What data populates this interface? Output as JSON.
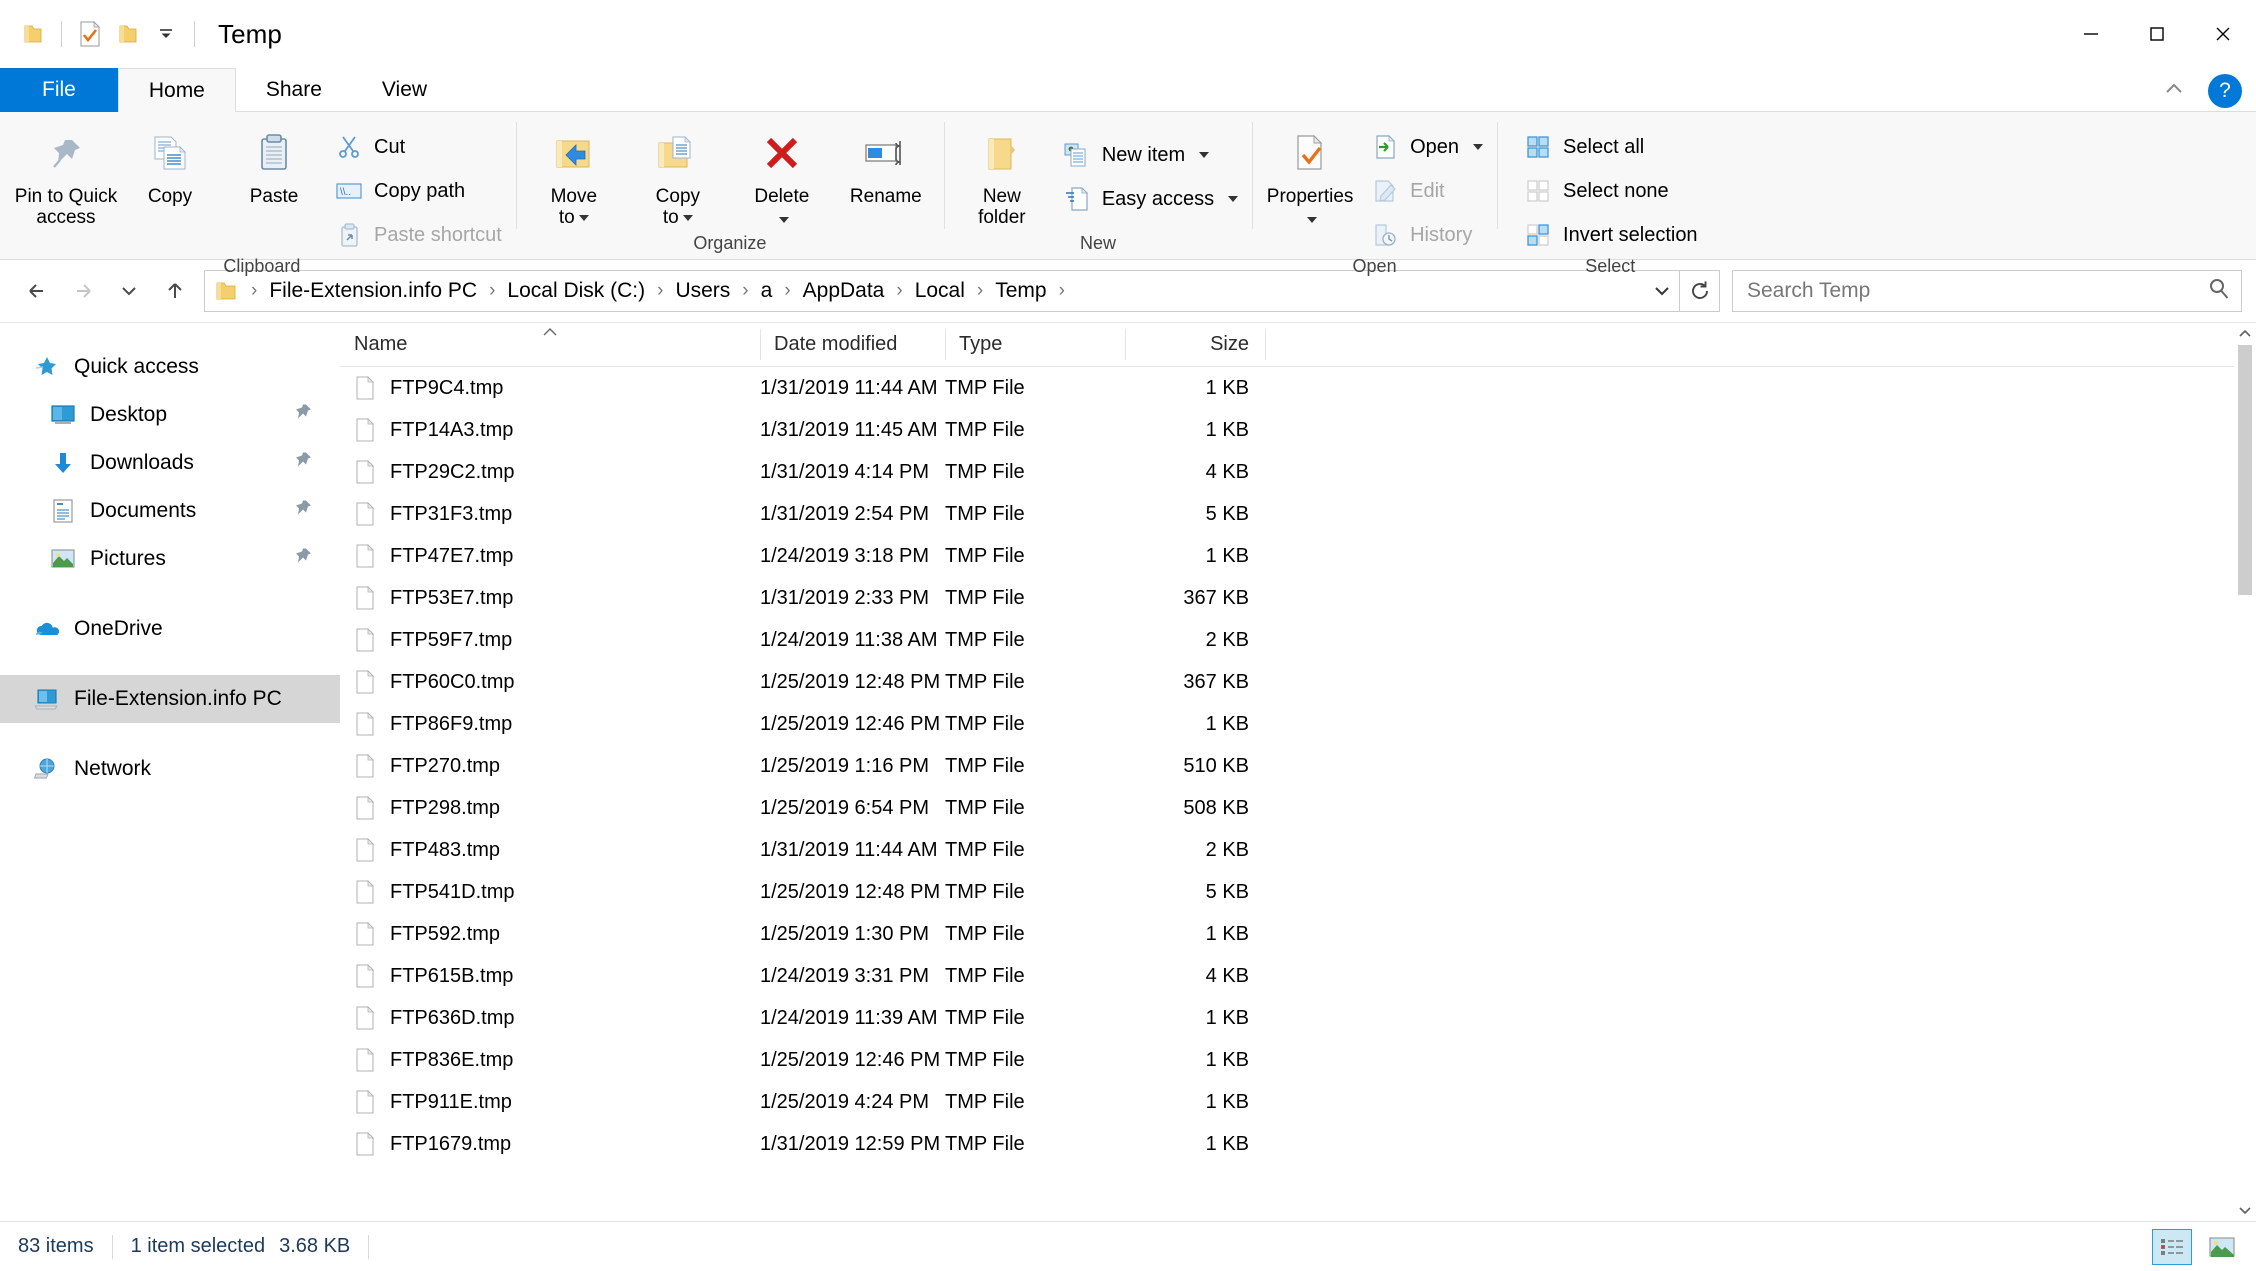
{
  "window": {
    "title": "Temp",
    "quick_access": [
      "folder-icon",
      "properties-icon",
      "new-folder-icon",
      "customize-qat-dropdown"
    ],
    "controls": {
      "minimize": "minimize-button",
      "maximize": "maximize-button",
      "close": "close-button"
    }
  },
  "tabs": [
    {
      "id": "file",
      "label": "File"
    },
    {
      "id": "home",
      "label": "Home"
    },
    {
      "id": "share",
      "label": "Share"
    },
    {
      "id": "view",
      "label": "View"
    }
  ],
  "active_tab": "Home",
  "ribbon": {
    "collapse_label": "collapse-ribbon-icon",
    "help_label": "?",
    "groups": [
      {
        "name": "Clipboard",
        "label": "Clipboard",
        "big_buttons": [
          {
            "label": "Pin to Quick\naccess",
            "line1": "Pin to Quick",
            "line2": "access",
            "icon": "pin-icon",
            "dim": false
          },
          {
            "label": "Copy",
            "line1": "Copy",
            "line2": "",
            "icon": "copy-icon",
            "dim": false
          },
          {
            "label": "Paste",
            "line1": "Paste",
            "line2": "",
            "icon": "paste-icon",
            "dim": false
          }
        ],
        "small_buttons": [
          {
            "label": "Cut",
            "icon": "scissors-icon",
            "dim": false
          },
          {
            "label": "Copy path",
            "icon": "copy-path-icon",
            "dim": false
          },
          {
            "label": "Paste shortcut",
            "icon": "paste-shortcut-icon",
            "dim": true
          }
        ]
      },
      {
        "name": "Organize",
        "label": "Organize",
        "big_buttons": [
          {
            "line1": "Move",
            "line2": "to",
            "icon": "move-to-icon",
            "has_caret": true
          },
          {
            "line1": "Copy",
            "line2": "to",
            "icon": "copy-to-icon",
            "has_caret": true
          },
          {
            "line1": "Delete",
            "line2": "",
            "icon": "delete-icon",
            "has_caret": true
          },
          {
            "line1": "Rename",
            "line2": "",
            "icon": "rename-icon",
            "has_caret": false
          }
        ],
        "small_buttons": []
      },
      {
        "name": "New",
        "label": "New",
        "big_buttons": [
          {
            "line1": "New",
            "line2": "folder",
            "icon": "new-folder-icon",
            "has_caret": false
          }
        ],
        "small_buttons": [
          {
            "label": "New item",
            "icon": "new-item-icon",
            "has_caret": true
          },
          {
            "label": "Easy access",
            "icon": "easy-access-icon",
            "has_caret": true
          }
        ]
      },
      {
        "name": "Open",
        "label": "Open",
        "big_buttons": [
          {
            "line1": "Properties",
            "line2": "",
            "icon": "properties-icon",
            "has_caret": true
          }
        ],
        "small_buttons": [
          {
            "label": "Open",
            "icon": "open-icon",
            "has_caret": true,
            "dim": false
          },
          {
            "label": "Edit",
            "icon": "edit-icon",
            "has_caret": false,
            "dim": true
          },
          {
            "label": "History",
            "icon": "history-icon",
            "has_caret": false,
            "dim": true
          }
        ]
      },
      {
        "name": "Select",
        "label": "Select",
        "big_buttons": [],
        "small_buttons": [
          {
            "label": "Select all",
            "icon": "select-all-icon",
            "dim": false
          },
          {
            "label": "Select none",
            "icon": "select-none-icon",
            "dim": false
          },
          {
            "label": "Invert selection",
            "icon": "invert-selection-icon",
            "dim": false
          }
        ]
      }
    ]
  },
  "address_bar": {
    "back": "back-arrow-icon",
    "forward": "forward-arrow-icon",
    "recent": "recent-locations-icon",
    "up": "up-arrow-icon",
    "folder_icon": "folder-icon",
    "breadcrumbs": [
      "File-Extension.info PC",
      "Local Disk (C:)",
      "Users",
      "a",
      "AppData",
      "Local",
      "Temp"
    ],
    "separator": "›",
    "dropdown": "address-dropdown-icon",
    "refresh": "refresh-icon"
  },
  "search": {
    "placeholder": "Search Temp",
    "value": "",
    "icon": "search-icon"
  },
  "nav_pane": {
    "items": [
      {
        "label": "Quick access",
        "icon": "quick-access-star-icon",
        "level": 0,
        "pinned": false,
        "selected": false
      },
      {
        "label": "Desktop",
        "icon": "desktop-icon",
        "level": 1,
        "pinned": true,
        "selected": false
      },
      {
        "label": "Downloads",
        "icon": "downloads-icon",
        "level": 1,
        "pinned": true,
        "selected": false
      },
      {
        "label": "Documents",
        "icon": "documents-icon",
        "level": 1,
        "pinned": true,
        "selected": false
      },
      {
        "label": "Pictures",
        "icon": "pictures-icon",
        "level": 1,
        "pinned": true,
        "selected": false
      },
      {
        "label": "OneDrive",
        "icon": "onedrive-cloud-icon",
        "level": 0,
        "pinned": false,
        "selected": false,
        "gap_before": true
      },
      {
        "label": "File-Extension.info PC",
        "icon": "this-pc-icon",
        "level": 0,
        "pinned": false,
        "selected": true,
        "gap_before": true
      },
      {
        "label": "Network",
        "icon": "network-icon",
        "level": 0,
        "pinned": false,
        "selected": false,
        "gap_before": true
      }
    ]
  },
  "file_list": {
    "columns": [
      {
        "key": "name",
        "label": "Name",
        "sorted": "asc"
      },
      {
        "key": "date",
        "label": "Date modified"
      },
      {
        "key": "type",
        "label": "Type"
      },
      {
        "key": "size",
        "label": "Size"
      }
    ],
    "rows": [
      {
        "name": "FTP9C4.tmp",
        "date": "1/31/2019 11:44 AM",
        "type": "TMP File",
        "size": "1 KB"
      },
      {
        "name": "FTP14A3.tmp",
        "date": "1/31/2019 11:45 AM",
        "type": "TMP File",
        "size": "1 KB"
      },
      {
        "name": "FTP29C2.tmp",
        "date": "1/31/2019 4:14 PM",
        "type": "TMP File",
        "size": "4 KB"
      },
      {
        "name": "FTP31F3.tmp",
        "date": "1/31/2019 2:54 PM",
        "type": "TMP File",
        "size": "5 KB"
      },
      {
        "name": "FTP47E7.tmp",
        "date": "1/24/2019 3:18 PM",
        "type": "TMP File",
        "size": "1 KB"
      },
      {
        "name": "FTP53E7.tmp",
        "date": "1/31/2019 2:33 PM",
        "type": "TMP File",
        "size": "367 KB"
      },
      {
        "name": "FTP59F7.tmp",
        "date": "1/24/2019 11:38 AM",
        "type": "TMP File",
        "size": "2 KB"
      },
      {
        "name": "FTP60C0.tmp",
        "date": "1/25/2019 12:48 PM",
        "type": "TMP File",
        "size": "367 KB"
      },
      {
        "name": "FTP86F9.tmp",
        "date": "1/25/2019 12:46 PM",
        "type": "TMP File",
        "size": "1 KB"
      },
      {
        "name": "FTP270.tmp",
        "date": "1/25/2019 1:16 PM",
        "type": "TMP File",
        "size": "510 KB"
      },
      {
        "name": "FTP298.tmp",
        "date": "1/25/2019 6:54 PM",
        "type": "TMP File",
        "size": "508 KB"
      },
      {
        "name": "FTP483.tmp",
        "date": "1/31/2019 11:44 AM",
        "type": "TMP File",
        "size": "2 KB"
      },
      {
        "name": "FTP541D.tmp",
        "date": "1/25/2019 12:48 PM",
        "type": "TMP File",
        "size": "5 KB"
      },
      {
        "name": "FTP592.tmp",
        "date": "1/25/2019 1:30 PM",
        "type": "TMP File",
        "size": "1 KB"
      },
      {
        "name": "FTP615B.tmp",
        "date": "1/24/2019 3:31 PM",
        "type": "TMP File",
        "size": "4 KB"
      },
      {
        "name": "FTP636D.tmp",
        "date": "1/24/2019 11:39 AM",
        "type": "TMP File",
        "size": "1 KB"
      },
      {
        "name": "FTP836E.tmp",
        "date": "1/25/2019 12:46 PM",
        "type": "TMP File",
        "size": "1 KB"
      },
      {
        "name": "FTP911E.tmp",
        "date": "1/25/2019 4:24 PM",
        "type": "TMP File",
        "size": "1 KB"
      },
      {
        "name": "FTP1679.tmp",
        "date": "1/31/2019 12:59 PM",
        "type": "TMP File",
        "size": "1 KB"
      }
    ]
  },
  "status_bar": {
    "item_count": "83 items",
    "selection": "1 item selected",
    "selection_size": "3.68 KB",
    "views": [
      {
        "name": "details-view-button",
        "selected": true
      },
      {
        "name": "large-icons-view-button",
        "selected": false
      }
    ]
  },
  "colors": {
    "accent": "#0078d7",
    "selection": "#d6d6d6",
    "status_text": "#1b3a5c",
    "folder": "#f7d98b"
  }
}
